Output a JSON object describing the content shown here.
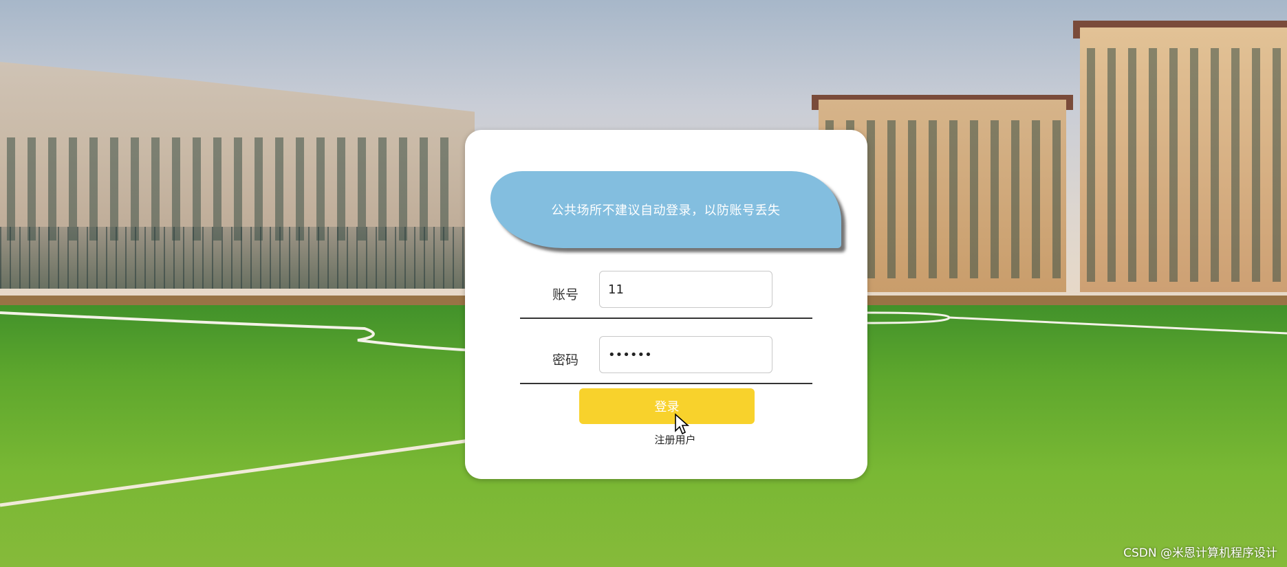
{
  "banner": {
    "text": "公共场所不建议自动登录，以防账号丢失"
  },
  "form": {
    "username_label": "账号",
    "username_value": "11",
    "password_label": "密码",
    "password_value": "123456",
    "login_label": "登录",
    "register_label": "注册用户"
  },
  "watermark": "CSDN @米恩计算机程序设计",
  "colors": {
    "banner": "#83bedf",
    "login_button": "#f8d22c"
  },
  "icons": {
    "cursor": "mouse-pointer-icon"
  }
}
